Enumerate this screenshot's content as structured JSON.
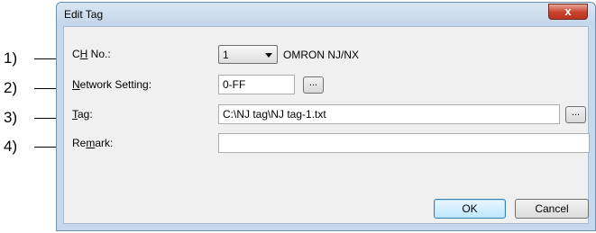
{
  "callouts": [
    "1)",
    "2)",
    "3)",
    "4)"
  ],
  "dialog": {
    "title": "Edit Tag",
    "close_label": "x"
  },
  "form": {
    "ch_no": {
      "label_pre": "C",
      "label_ul": "H",
      "label_post": " No.:",
      "selected": "1",
      "device": "OMRON NJ/NX"
    },
    "network_setting": {
      "label_ul": "N",
      "label_post": "etwork Setting:",
      "value": "0-FF",
      "browse_label": "..."
    },
    "tag": {
      "label_ul": "T",
      "label_post": "ag:",
      "value": "C:\\NJ tag\\NJ tag-1.txt",
      "browse_label": "..."
    },
    "remark": {
      "label_pre": "Re",
      "label_ul": "m",
      "label_post": "ark:",
      "value": ""
    }
  },
  "buttons": {
    "ok": "OK",
    "cancel": "Cancel"
  }
}
